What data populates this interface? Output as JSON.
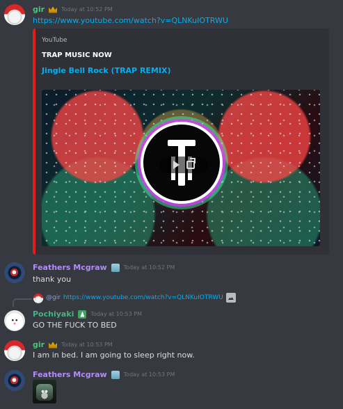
{
  "colors": {
    "background": "#36393f",
    "text": "#dcddde",
    "timestamp": "#72767d",
    "link": "#00b0f4",
    "gir_name": "#4cc37a",
    "feathers_name": "#b38bfe",
    "pochi_name": "#43b581",
    "embed_bg": "#2f3136",
    "embed_stripe": "#e31c1c"
  },
  "messages": [
    {
      "author": "gir",
      "timestamp": "Today at 10:52 PM",
      "text": "https://www.youtube.com/watch?v=QLNKuIOTRWU",
      "badge_icon": "crown-icon",
      "avatar_icon": "santa-avatar-icon"
    },
    {
      "author": "Feathers Mcgraw",
      "timestamp": "Today at 10:52 PM",
      "text": "thank you",
      "badge_icon": "robot-icon",
      "avatar_icon": "feathers-avatar-icon"
    },
    {
      "author": "Pochiyaki",
      "timestamp": "Today at 10:53 PM",
      "text": "GO THE FUCK TO BED",
      "badge_icon": "leaf-icon",
      "avatar_icon": "pochi-avatar-icon",
      "reply": {
        "mention": "@gir",
        "text": "https://www.youtube.com/watch?v=QLNKuIOTRWU",
        "image_icon": "image-icon"
      }
    },
    {
      "author": "gir",
      "timestamp": "Today at 10:53 PM",
      "text": "I am in bed. I am going to sleep right now.",
      "badge_icon": "crown-icon",
      "avatar_icon": "santa-avatar-icon"
    },
    {
      "author": "Feathers Mcgraw",
      "timestamp": "Today at 10:53 PM",
      "text": "",
      "badge_icon": "robot-icon",
      "avatar_icon": "feathers-avatar-icon",
      "sticker_icon": "gremlin-sticker-icon"
    }
  ],
  "embed": {
    "provider": "YouTube",
    "author": "TRAP MUSIC NOW",
    "title": "Jingle Bell Rock (TRAP REMIX)",
    "thumbnail_icon": "video-thumbnail",
    "play_icon": "play-icon",
    "external_icon": "open-external-icon"
  }
}
